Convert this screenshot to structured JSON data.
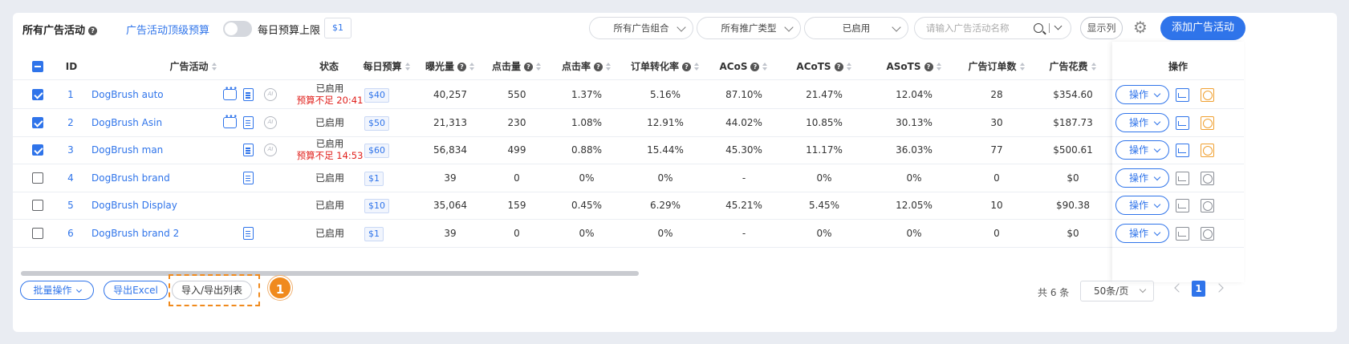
{
  "toolbar": {
    "title": "所有广告活动",
    "top_budget_label": "广告活动顶级预算",
    "top_budget_enabled": false,
    "daily_limit_label": "每日预算上限",
    "daily_limit_value": "$1",
    "filter_portfolio": "所有广告组合",
    "filter_type": "所有推广类型",
    "filter_status": "已启用",
    "search_placeholder": "请输入广告活动名称",
    "columns_button": "显示列",
    "add_button": "添加广告活动"
  },
  "table": {
    "headers": {
      "id": "ID",
      "campaign": "广告活动",
      "status": "状态",
      "budget": "每日预算",
      "impressions": "曝光量",
      "clicks": "点击量",
      "ctr": "点击率",
      "cvr": "订单转化率",
      "acos": "ACoS",
      "acots": "ACoTS",
      "asots": "ASoTS",
      "orders": "广告订单数",
      "spend": "广告花费",
      "actions": "操作"
    },
    "rows": [
      {
        "id": "1",
        "name": "DogBrush auto",
        "status": "已启用",
        "warn": "预算不足 20:41",
        "budget": "$40",
        "impressions": "40,257",
        "clicks": "550",
        "ctr": "1.37%",
        "cvr": "5.16%",
        "acos": "87.10%",
        "acots": "21.47%",
        "asots": "12.04%",
        "orders": "28",
        "spend": "$354.60",
        "action": "操作"
      },
      {
        "id": "2",
        "name": "DogBrush Asin",
        "status": "已启用",
        "warn": "",
        "budget": "$50",
        "impressions": "21,313",
        "clicks": "230",
        "ctr": "1.08%",
        "cvr": "12.91%",
        "acos": "44.02%",
        "acots": "10.85%",
        "asots": "30.13%",
        "orders": "30",
        "spend": "$187.73",
        "action": "操作"
      },
      {
        "id": "3",
        "name": "DogBrush man",
        "status": "已启用",
        "warn": "预算不足 14:53",
        "budget": "$60",
        "impressions": "56,834",
        "clicks": "499",
        "ctr": "0.88%",
        "cvr": "15.44%",
        "acos": "45.30%",
        "acots": "11.17%",
        "asots": "36.03%",
        "orders": "77",
        "spend": "$500.61",
        "action": "操作"
      },
      {
        "id": "4",
        "name": "DogBrush brand",
        "status": "已启用",
        "warn": "",
        "budget": "$1",
        "impressions": "39",
        "clicks": "0",
        "ctr": "0%",
        "cvr": "0%",
        "acos": "-",
        "acots": "0%",
        "asots": "0%",
        "orders": "0",
        "spend": "$0",
        "action": "操作"
      },
      {
        "id": "5",
        "name": "DogBrush Display",
        "status": "已启用",
        "warn": "",
        "budget": "$10",
        "impressions": "35,064",
        "clicks": "159",
        "ctr": "0.45%",
        "cvr": "6.29%",
        "acos": "45.21%",
        "acots": "5.45%",
        "asots": "12.05%",
        "orders": "10",
        "spend": "$90.38",
        "action": "操作"
      },
      {
        "id": "6",
        "name": "DogBrush brand 2",
        "status": "已启用",
        "warn": "",
        "budget": "$1",
        "impressions": "39",
        "clicks": "0",
        "ctr": "0%",
        "cvr": "0%",
        "acos": "-",
        "acots": "0%",
        "asots": "0%",
        "orders": "0",
        "spend": "$0",
        "action": "操作"
      }
    ],
    "ai_icon_text": "AI"
  },
  "footer": {
    "bulk_button": "批量操作",
    "export_button": "导出Excel",
    "import_export_button": "导入/导出列表",
    "callout_number": "1",
    "total_text": "共 6 条",
    "page_size": "50条/页",
    "current_page": "1"
  },
  "colors": {
    "accent": "#2f74ea",
    "warning": "#e0201c",
    "highlight": "#f08a1d"
  }
}
